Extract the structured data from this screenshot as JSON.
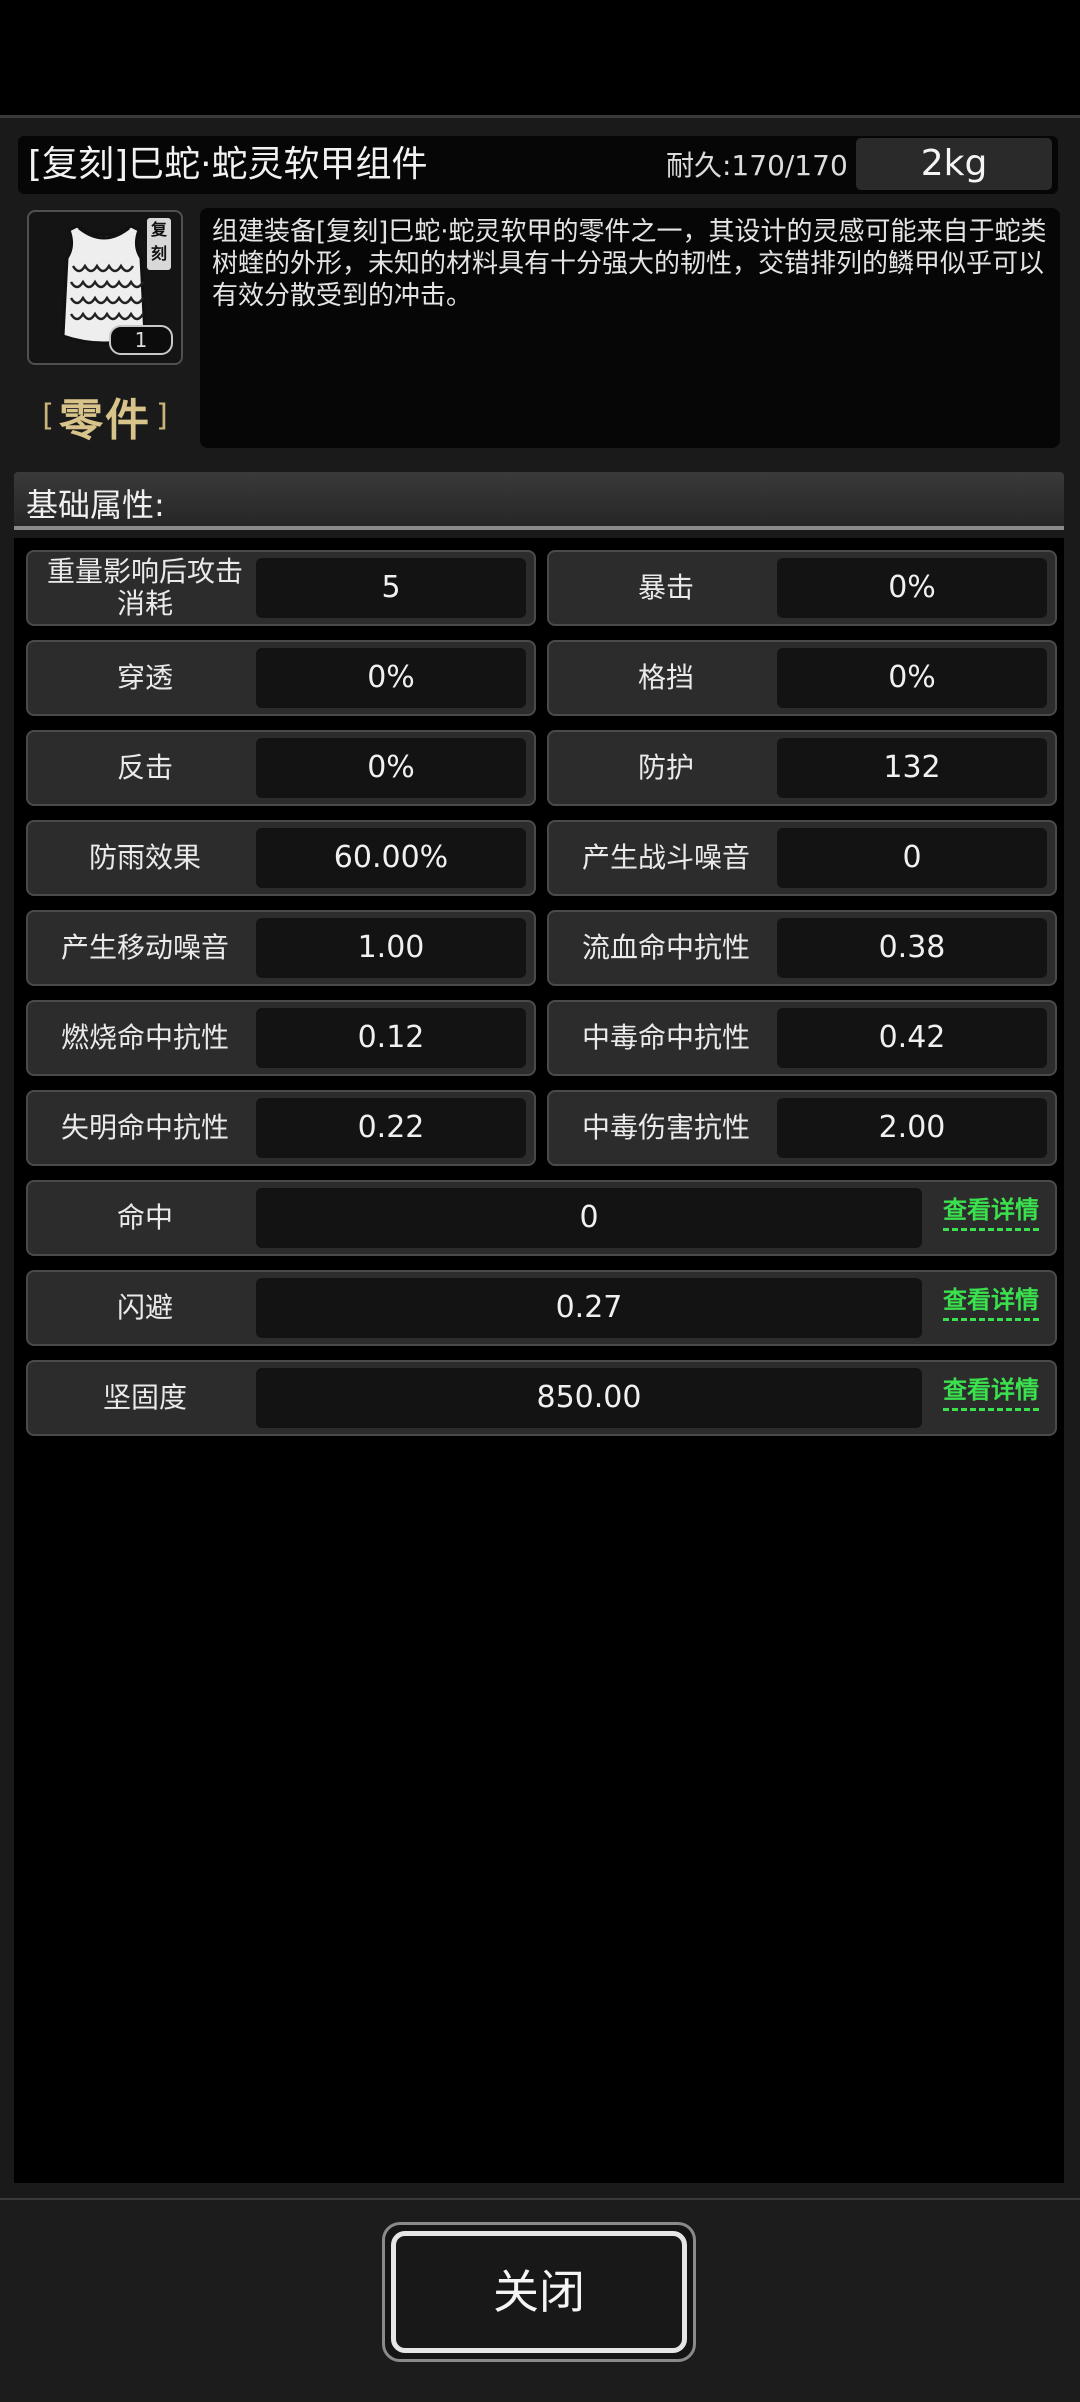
{
  "header": {
    "title": "[复刻]巳蛇·蛇灵软甲组件",
    "durability": "耐久:170/170",
    "weight": "2kg"
  },
  "item": {
    "icon_name": "armor-vest-icon",
    "reprint_tag": "复刻",
    "count": "1",
    "type_bracket_left": "[",
    "type_label": "零件",
    "type_bracket_right": "]",
    "description": "组建装备[复刻]巳蛇·蛇灵软甲的零件之一，其设计的灵感可能来自于蛇类树蝰的外形，未知的材料具有十分强大的韧性，交错排列的鳞甲似乎可以有效分散受到的冲击。"
  },
  "section": {
    "title": "基础属性:"
  },
  "attributes": [
    {
      "label": "重量影响后攻击消耗",
      "value": "5"
    },
    {
      "label": "暴击",
      "value": "0%"
    },
    {
      "label": "穿透",
      "value": "0%"
    },
    {
      "label": "格挡",
      "value": "0%"
    },
    {
      "label": "反击",
      "value": "0%"
    },
    {
      "label": "防护",
      "value": "132"
    },
    {
      "label": "防雨效果",
      "value": "60.00%"
    },
    {
      "label": "产生战斗噪音",
      "value": "0"
    },
    {
      "label": "产生移动噪音",
      "value": "1.00"
    },
    {
      "label": "流血命中抗性",
      "value": "0.38"
    },
    {
      "label": "燃烧命中抗性",
      "value": "0.12"
    },
    {
      "label": "中毒命中抗性",
      "value": "0.42"
    },
    {
      "label": "失明命中抗性",
      "value": "0.22"
    },
    {
      "label": "中毒伤害抗性",
      "value": "2.00"
    }
  ],
  "wide_attributes": [
    {
      "label": "命中",
      "value": "0",
      "link": "查看详情"
    },
    {
      "label": "闪避",
      "value": "0.27",
      "link": "查看详情"
    },
    {
      "label": "坚固度",
      "value": "850.00",
      "link": "查看详情"
    }
  ],
  "footer": {
    "close_label": "关闭"
  },
  "colors": {
    "link": "#3be04e",
    "type_label": "#d8c48a"
  }
}
